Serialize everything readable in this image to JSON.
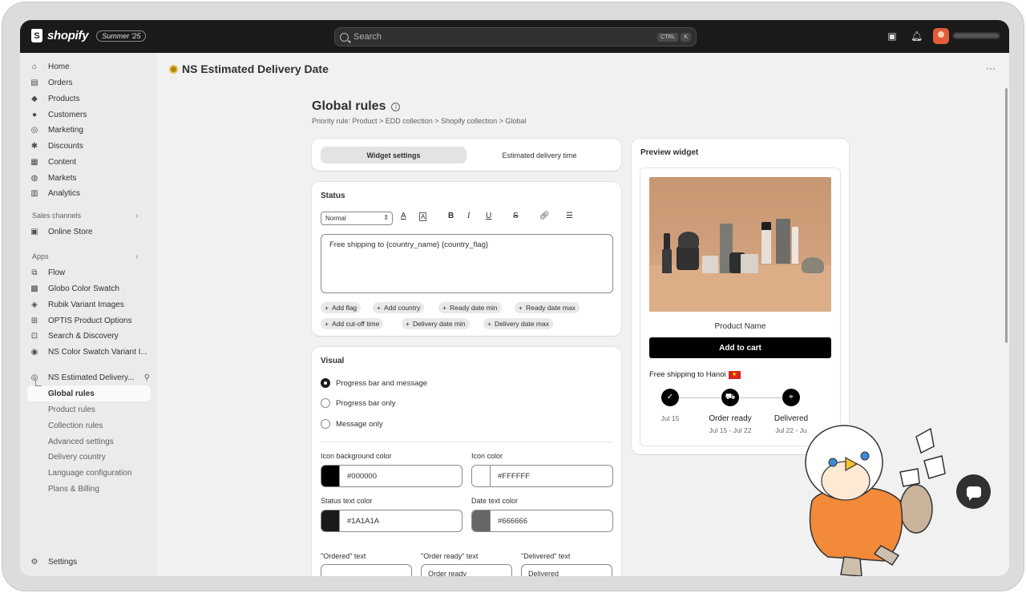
{
  "topbar": {
    "brand": "shopify",
    "edition": "Summer '25",
    "search_placeholder": "Search",
    "shortcut_ctrl": "CTRL",
    "shortcut_k": "K"
  },
  "sidebar": {
    "main": [
      "Home",
      "Orders",
      "Products",
      "Customers",
      "Marketing",
      "Discounts",
      "Content",
      "Markets",
      "Analytics"
    ],
    "sales_channels_heading": "Sales channels",
    "online_store": "Online Store",
    "apps_heading": "Apps",
    "apps": [
      "Flow",
      "Globo Color Swatch",
      "Rubik Variant Images",
      "OPTIS Product Options",
      "Search & Discovery",
      "NS Color Swatch Variant I..."
    ],
    "current_app": "NS Estimated Delivery...",
    "sub_items": [
      "Global rules",
      "Product rules",
      "Collection rules",
      "Advanced settings",
      "Delivery country",
      "Language configuration",
      "Plans & Billing"
    ],
    "settings": "Settings"
  },
  "page": {
    "app_title": "NS Estimated Delivery Date",
    "heading": "Global rules",
    "priority_rule": "Priority rule: Product > EDD collection > Shopify collection > Global"
  },
  "tabs": [
    "Widget settings",
    "Estimated delivery time"
  ],
  "status": {
    "title": "Status",
    "format_select": "Normal",
    "editor_text": "Free shipping to {country_name} {country_flag}",
    "chips": [
      "Add flag",
      "Add country",
      "Ready date min",
      "Ready date max",
      "Add cut-off time",
      "Delivery date min",
      "Delivery date max"
    ]
  },
  "visual": {
    "title": "Visual",
    "options": [
      "Progress bar and message",
      "Progress bar only",
      "Message only"
    ],
    "selected": "Progress bar and message",
    "icon_bg_label": "Icon background color",
    "icon_bg_value": "#000000",
    "icon_color_label": "Icon color",
    "icon_color_value": "#FFFFFF",
    "status_text_label": "Status text color",
    "status_text_value": "#1A1A1A",
    "date_text_label": "Date text color",
    "date_text_value": "#666666",
    "ordered_label": "\"Ordered\" text",
    "ordered_value": "",
    "order_ready_label": "\"Order ready\" text",
    "order_ready_value": "Order ready",
    "delivered_label": "\"Delivered\" text",
    "delivered_value": "Delivered"
  },
  "preview": {
    "title": "Preview widget",
    "product_name": "Product Name",
    "add_to_cart": "Add to cart",
    "shipping_message": "Free shipping to Hanoi",
    "steps": [
      {
        "title": "",
        "date": "Jul 15"
      },
      {
        "title": "Order ready",
        "date": "Jul 15 - Jul 22"
      },
      {
        "title": "Delivered",
        "date": "Jul 22 - Ju"
      }
    ]
  },
  "colors": {
    "topbar": "#1a1a1a",
    "icon_background": "#000000",
    "icon_color": "#FFFFFF",
    "status_text": "#1A1A1A",
    "date_text": "#666666"
  }
}
